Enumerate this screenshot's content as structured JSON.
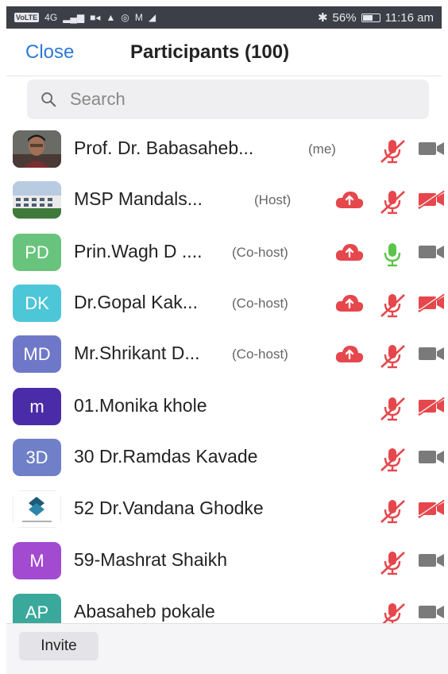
{
  "status_bar": {
    "volte": "VoLTE",
    "signal": "4G",
    "battery": "56%",
    "time": "11:16 am"
  },
  "header": {
    "close_label": "Close",
    "title": "Participants (100)"
  },
  "search": {
    "placeholder": "Search"
  },
  "participants": [
    {
      "name": "Prof. Dr. Babasaheb...",
      "role": "(me)",
      "avatar_text": "",
      "avatar_color": "#3a3a3a",
      "cloud": false,
      "mic": "muted",
      "camera": "on"
    },
    {
      "name": "MSP Mandals...",
      "role": "(Host)",
      "avatar_text": "",
      "avatar_color": "#5f7a96",
      "cloud": true,
      "mic": "muted",
      "camera": "off"
    },
    {
      "name": "Prin.Wagh D ....",
      "role": "(Co-host)",
      "avatar_text": "PD",
      "avatar_color": "#68c47c",
      "cloud": true,
      "mic": "active",
      "camera": "on"
    },
    {
      "name": "Dr.Gopal Kak...",
      "role": "(Co-host)",
      "avatar_text": "DK",
      "avatar_color": "#4dc6d8",
      "cloud": true,
      "mic": "muted",
      "camera": "off"
    },
    {
      "name": "Mr.Shrikant D...",
      "role": "(Co-host)",
      "avatar_text": "MD",
      "avatar_color": "#6f78c8",
      "cloud": true,
      "mic": "muted",
      "camera": "on"
    },
    {
      "name": "01.Monika khole",
      "role": "",
      "avatar_text": "m",
      "avatar_color": "#4a2ca8",
      "cloud": false,
      "mic": "muted",
      "camera": "off"
    },
    {
      "name": "30 Dr.Ramdas Kavade",
      "role": "",
      "avatar_text": "3D",
      "avatar_color": "#6f80c8",
      "cloud": false,
      "mic": "muted",
      "camera": "on"
    },
    {
      "name": "52 Dr.Vandana Ghodke",
      "role": "",
      "avatar_text": "",
      "avatar_color": "#ffffff",
      "cloud": false,
      "mic": "muted",
      "camera": "off"
    },
    {
      "name": "59-Mashrat Shaikh",
      "role": "",
      "avatar_text": "M",
      "avatar_color": "#a24ad0",
      "cloud": false,
      "mic": "muted",
      "camera": "on"
    },
    {
      "name": "Abasaheb pokale",
      "role": "",
      "avatar_text": "AP",
      "avatar_color": "#3aa89a",
      "cloud": false,
      "mic": "muted",
      "camera": "on"
    }
  ],
  "footer": {
    "invite_label": "Invite"
  },
  "colors": {
    "accent": "#2d7ad6",
    "muted_red": "#e5474c",
    "mic_active": "#5cc44a",
    "camera_gray": "#7a7a7a"
  }
}
